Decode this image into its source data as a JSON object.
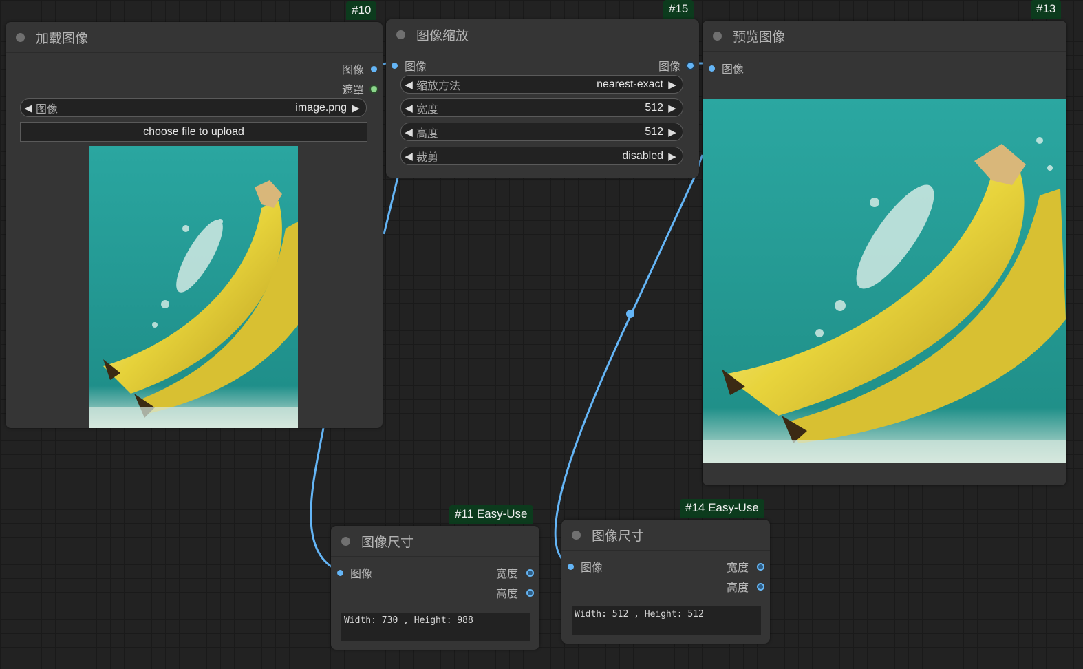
{
  "colors": {
    "canvas": "#222222",
    "node_bg": "#353535",
    "badge_bg": "#0c3b1d",
    "link": "#64b5f6",
    "image_slot": "#64b5f6",
    "mask_slot": "#8bd68b",
    "int_slot": "#2f5e86"
  },
  "nodes": {
    "load_image": {
      "badge": "#10",
      "title": "加载图像",
      "outputs": [
        "图像",
        "遮罩"
      ],
      "widget": {
        "label": "图像",
        "value": "image.png"
      },
      "upload_label": "choose file to upload",
      "preview": "banana-bunch-splash-image"
    },
    "image_scale": {
      "badge": "#15",
      "title": "图像缩放",
      "input": "图像",
      "output": "图像",
      "widgets": [
        {
          "label": "缩放方法",
          "value": "nearest-exact"
        },
        {
          "label": "宽度",
          "value": "512"
        },
        {
          "label": "高度",
          "value": "512"
        },
        {
          "label": "裁剪",
          "value": "disabled"
        }
      ]
    },
    "preview_image": {
      "badge": "#13",
      "title": "预览图像",
      "input": "图像",
      "preview": "banana-bunch-splash-image"
    },
    "image_size_11": {
      "badge": "#11 Easy-Use",
      "title": "图像尺寸",
      "input": "图像",
      "outputs": [
        "宽度",
        "高度"
      ],
      "text": "Width: 730 , Height: 988"
    },
    "image_size_14": {
      "badge": "#14 Easy-Use",
      "title": "图像尺寸",
      "input": "图像",
      "outputs": [
        "宽度",
        "高度"
      ],
      "text": "Width: 512 , Height: 512"
    }
  }
}
